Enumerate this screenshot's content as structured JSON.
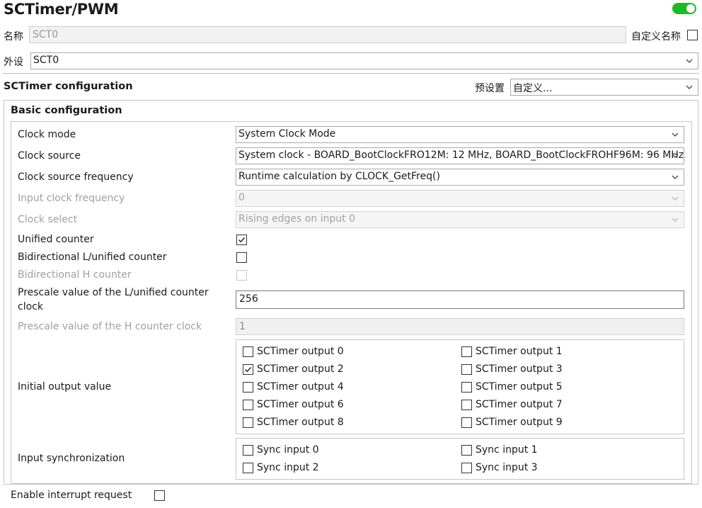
{
  "header": {
    "title": "SCTimer/PWM",
    "toggle_on": true,
    "toggle_color": "#1fb829"
  },
  "name_row": {
    "label": "名称",
    "value": "SCT0",
    "custom_name_label": "自定义名称",
    "custom_name_checked": false
  },
  "peripheral_row": {
    "label": "外设",
    "value": "SCT0"
  },
  "config": {
    "title": "SCTimer configuration",
    "preset_label": "预设置",
    "preset_value": "自定义..."
  },
  "basic": {
    "title": "Basic configuration",
    "clock_mode": {
      "label": "Clock mode",
      "value": "System Clock Mode"
    },
    "clock_source": {
      "label": "Clock source",
      "value": "System clock - BOARD_BootClockFRO12M: 12 MHz, BOARD_BootClockFROHF96M: 96 MHz"
    },
    "clock_source_freq": {
      "label": "Clock source frequency",
      "value": "Runtime calculation by CLOCK_GetFreq()"
    },
    "input_clock_freq": {
      "label": "Input clock frequency",
      "value": "0"
    },
    "clock_select": {
      "label": "Clock select",
      "value": "Rising edges on input 0"
    },
    "unified_counter": {
      "label": "Unified counter",
      "checked": true
    },
    "bidir_l": {
      "label": "Bidirectional L/unified counter",
      "checked": false
    },
    "bidir_h": {
      "label": "Bidirectional H counter",
      "checked": false
    },
    "prescale_l": {
      "label_line1": "Prescale value of the L/unified counter",
      "label_line2": "clock",
      "value": "256"
    },
    "prescale_h": {
      "label": "Prescale value of the H counter clock",
      "value": "1"
    },
    "initial_output": {
      "label": "Initial output value",
      "outputs": [
        {
          "label": "SCTimer output 0",
          "checked": false
        },
        {
          "label": "SCTimer output 1",
          "checked": false
        },
        {
          "label": "SCTimer output 2",
          "checked": true
        },
        {
          "label": "SCTimer output 3",
          "checked": false
        },
        {
          "label": "SCTimer output 4",
          "checked": false
        },
        {
          "label": "SCTimer output 5",
          "checked": false
        },
        {
          "label": "SCTimer output 6",
          "checked": false
        },
        {
          "label": "SCTimer output 7",
          "checked": false
        },
        {
          "label": "SCTimer output 8",
          "checked": false
        },
        {
          "label": "SCTimer output 9",
          "checked": false
        }
      ]
    },
    "input_sync": {
      "label": "Input synchronization",
      "inputs": [
        {
          "label": "Sync input 0",
          "checked": false
        },
        {
          "label": "Sync input 1",
          "checked": false
        },
        {
          "label": "Sync input 2",
          "checked": false
        },
        {
          "label": "Sync input 3",
          "checked": false
        }
      ]
    }
  },
  "interrupt": {
    "label": "Enable interrupt request",
    "checked": false
  },
  "icons": {
    "chevron": "chevron-down-icon",
    "check": "check-icon"
  }
}
